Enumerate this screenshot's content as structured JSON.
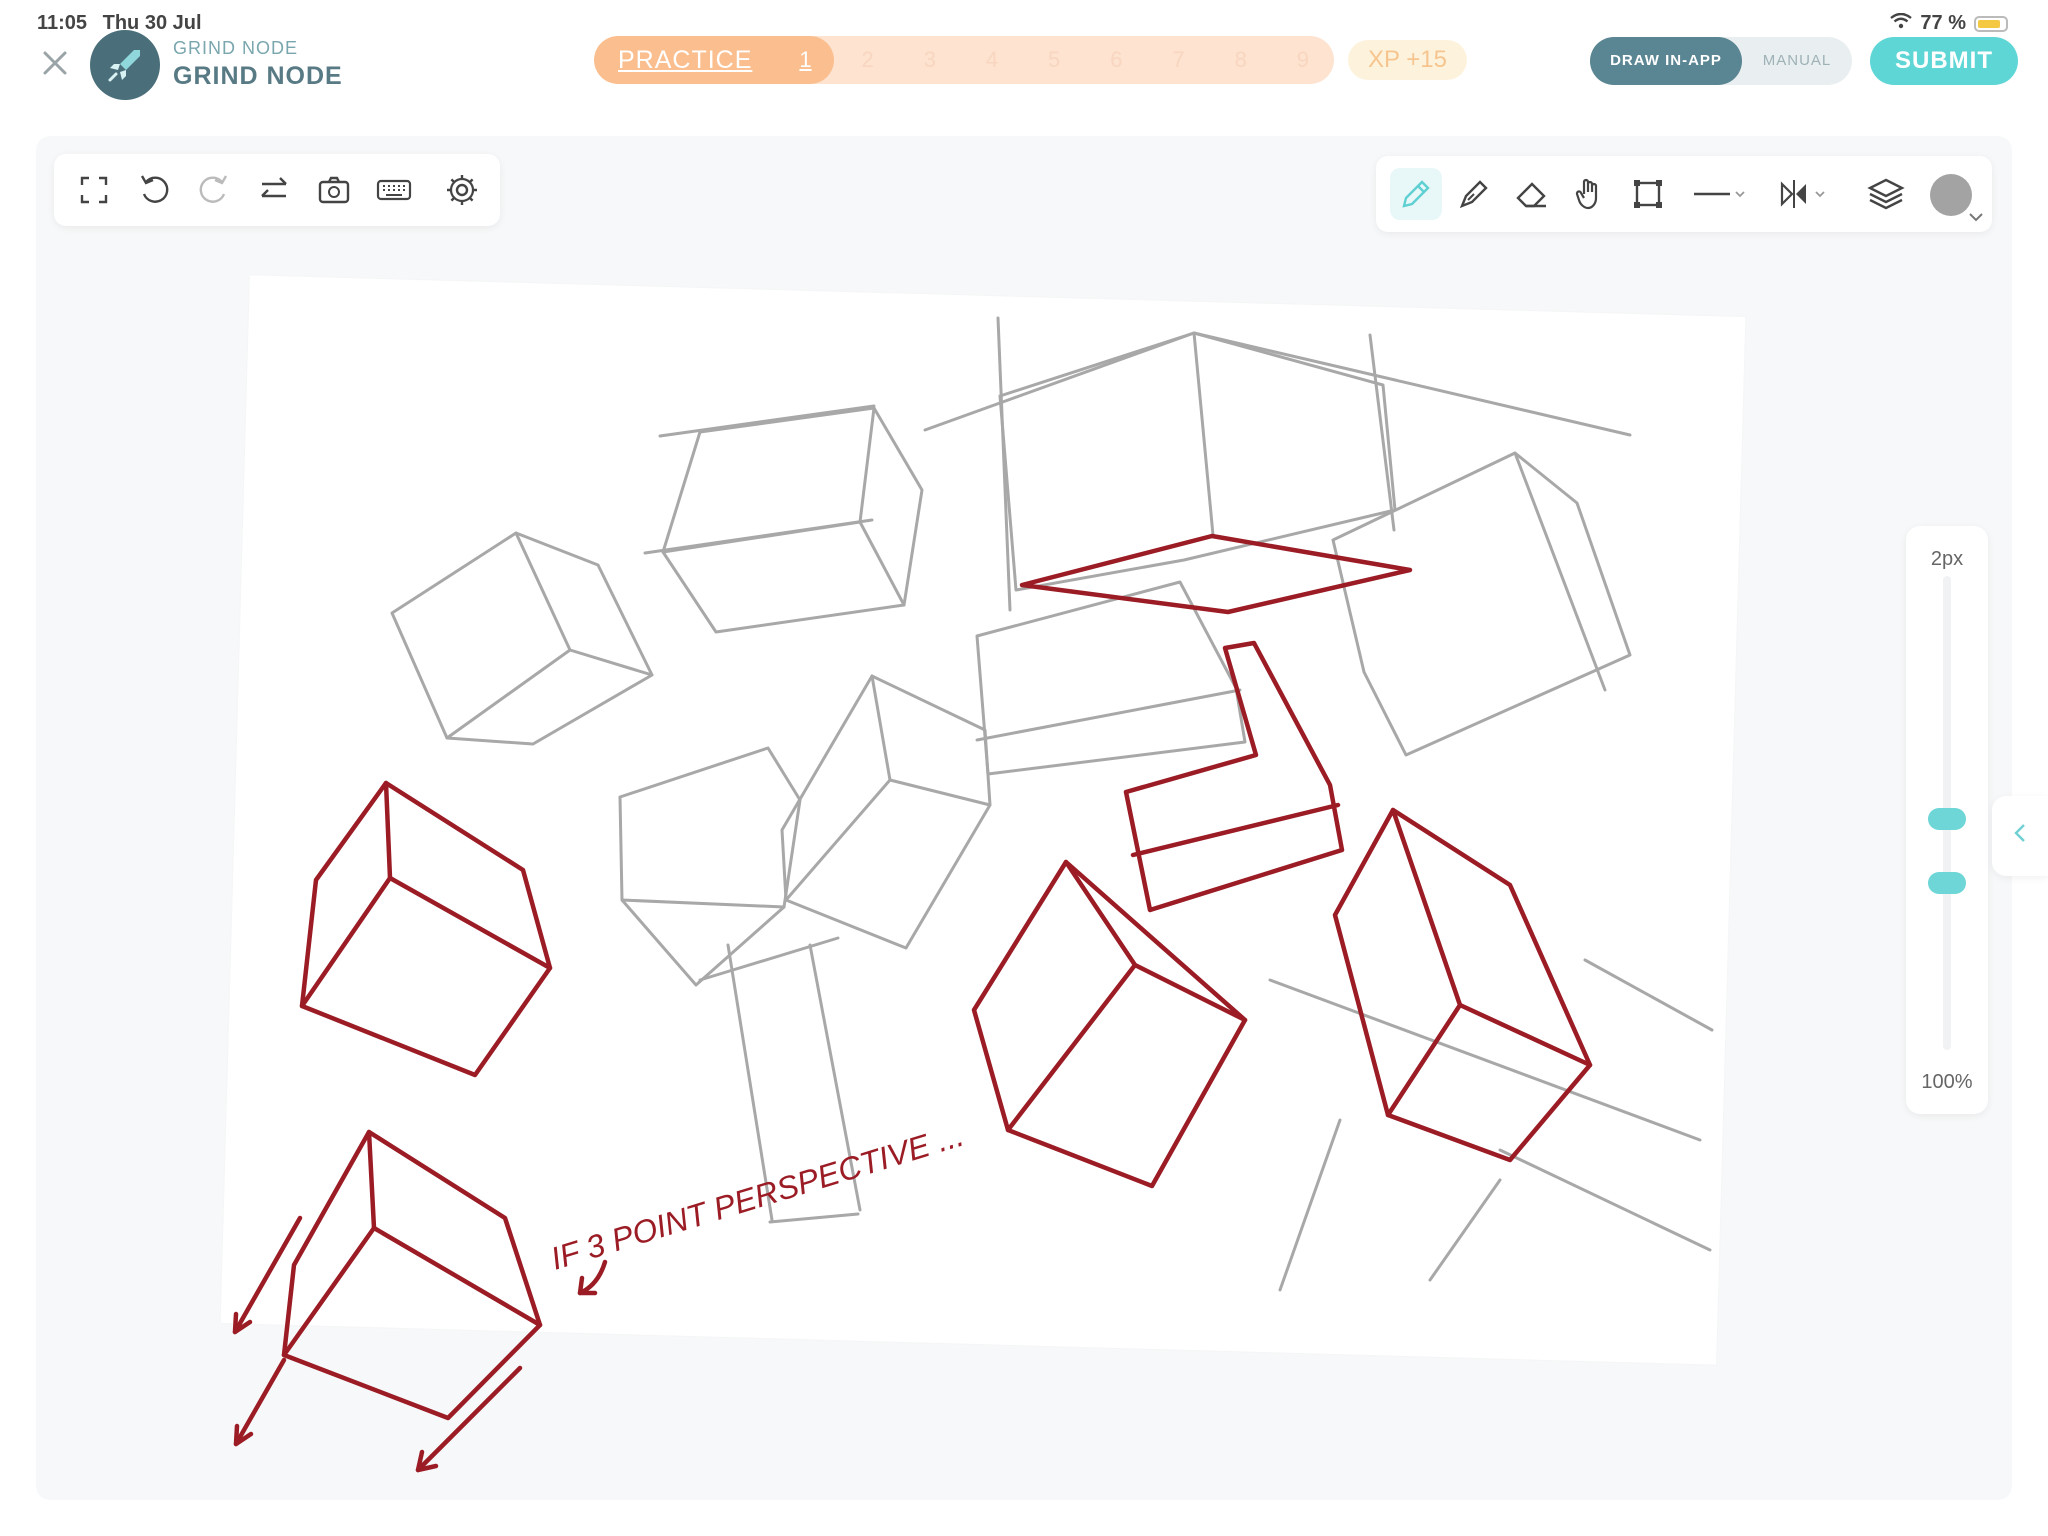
{
  "status": {
    "time": "11:05",
    "date": "Thu 30 Jul",
    "battery": "77 %",
    "battery_level": 0.77
  },
  "header": {
    "brand_small": "GRIND NODE",
    "brand_big": "GRIND NODE",
    "practice_label": "PRACTICE",
    "steps": [
      "1",
      "2",
      "3",
      "4",
      "5",
      "6",
      "7",
      "8",
      "9"
    ],
    "active_step": "1",
    "xp": "XP +15",
    "mode_on": "DRAW IN-APP",
    "mode_off": "MANUAL",
    "submit": "SUBMIT"
  },
  "toolbar_left": {
    "icons": [
      "fullscreen-icon",
      "undo-icon",
      "redo-icon",
      "swap-icon",
      "camera-rotate-icon",
      "keyboard-icon",
      "settings-icon"
    ]
  },
  "toolbar_right": {
    "icons": [
      "pencil-icon",
      "pen-icon",
      "eraser-icon",
      "hand-icon",
      "transform-icon",
      "line-style-icon",
      "symmetry-icon",
      "layers-icon"
    ],
    "color": "#a3a3a3"
  },
  "brush": {
    "size_label": "2px",
    "opacity_label": "100%"
  },
  "canvas": {
    "annotation": "IF 3 POINT PERSPECTIVE ...",
    "stroke_red": "#9b1c24",
    "stroke_gray": "#a8a8a8"
  },
  "colors": {
    "accent": "#5fd6d6",
    "progress": "#fbbf8f",
    "mode": "#5a8592"
  }
}
